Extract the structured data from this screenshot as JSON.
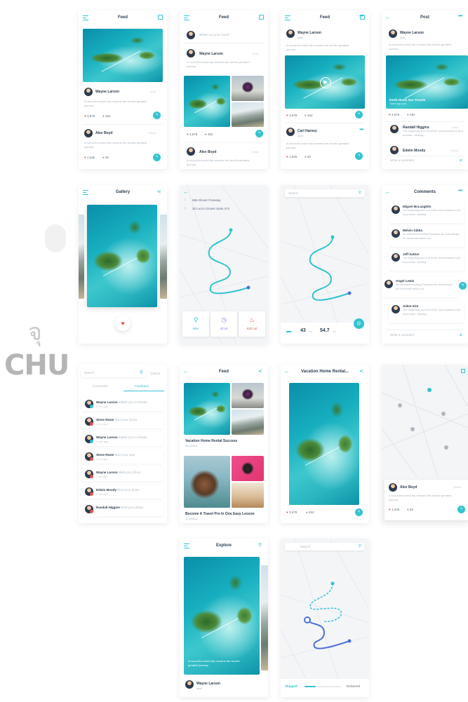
{
  "watermark": {
    "thai": "จุ",
    "latin": "CHU"
  },
  "colors": {
    "accent": "#34c3d1",
    "heart": "#e2574c",
    "route": "#4c6fd8",
    "calories": "#e2574c"
  },
  "feed1": {
    "title": "Feed",
    "post1": {
      "name": "Wayne Larson",
      "time": "2min",
      "text": "A round-the-world trip remains the world's greatest journey.",
      "likes": "3,578",
      "comments": "452"
    },
    "post2": {
      "name": "Alex Boyd",
      "time": "20min",
      "text": "A round-the-world trip remains the world's greatest journey.",
      "likes": "1,345",
      "comments": "82"
    }
  },
  "feed2": {
    "title": "Feed",
    "composer_placeholder": "What's on your mind?",
    "post1": {
      "name": "Wayne Larson",
      "time": "2min",
      "text": "A round-the-world trip remains the world's greatest journey.",
      "likes": "3,578",
      "comments": "452"
    },
    "post2": {
      "name": "Alex Boyd",
      "time": "5min",
      "text": "A round-the-world trip remains the world's greatest journey."
    }
  },
  "feed3": {
    "title": "Feed",
    "post1": {
      "name": "Wayne Larson",
      "handle": "@wl",
      "text": "A round-the-world trip remains the world's greatest journey.",
      "likes": "3,578",
      "comments": "452"
    },
    "post2": {
      "name": "Carl Harvey",
      "handle": "@ch",
      "text": "A round-the-world trip remains the world's greatest journey.",
      "likes": "1,345",
      "comments": "82"
    }
  },
  "post": {
    "title": "Post",
    "author": {
      "name": "Wayne Larson",
      "handle": "@wl"
    },
    "text": "A round-the-world trip remains the world's greatest journey.",
    "image_caption": "Earth Hosts Our Travels",
    "image_sub": "Travel app.com",
    "likes": "3,578",
    "comments": "452",
    "c1": {
      "name": "Randall Higgins",
      "time": "1min",
      "text": "The beginning and end of the novel showed a lot of promise...dealing..."
    },
    "c2": {
      "name": "Edwin Moody",
      "time": "12min"
    },
    "write_placeholder": "Write a comment"
  },
  "gallery": {
    "title": "Gallery"
  },
  "route": {
    "from": "696 Glover Freeway",
    "to": "30 Lucio Groves Suite 474",
    "bike": "Bike",
    "time": "43:16",
    "cal": "820 cal"
  },
  "map2": {
    "search_placeholder": "Search",
    "distance_min": "43",
    "distance_min_unit": "min",
    "distance_km": "54.7",
    "distance_km_unit": "km"
  },
  "comments": {
    "title": "Comments",
    "items": [
      {
        "name": "Miguel McLaughlin",
        "text": "The beginning and end of the novel showed a lot of promise...dealing..."
      },
      {
        "name": "Melvin Gibbs",
        "text": "As collective traveling Parapers we must always be concerned about our"
      },
      {
        "name": "Jeff Sutton",
        "text": "The beginning and end of the novel showed a lot of promise...dealing..."
      },
      {
        "name": "Angel Lewis",
        "text": "As collective traveling Parapers we must always be concerned about our"
      },
      {
        "name": "Aiden Kim",
        "text": "The beginning and end of the novel showed a lot of promise...dealing..."
      }
    ],
    "write_placeholder": "Write a comment"
  },
  "notifications": {
    "search_placeholder": "Search",
    "cancel": "Cancel",
    "tab1": "Comments",
    "tab2": "Feedback",
    "items": [
      {
        "name": "Wayne Larson",
        "action": "added you to friends",
        "ago": "2 hrs ago"
      },
      {
        "name": "Steve Rowe",
        "action": "liked your photo",
        "ago": "3 hrs ago"
      },
      {
        "name": "Wayne Larson",
        "action": "added you to friends",
        "ago": "1 day ago"
      },
      {
        "name": "Steve Rowe",
        "action": "liked your post",
        "ago": "2 hrs ago"
      },
      {
        "name": "Wayne Larson",
        "action": "liked your photo",
        "ago": "1 hrs ago"
      },
      {
        "name": "Edwin Moody",
        "action": "liked your photo",
        "ago": "2 hrs ago"
      },
      {
        "name": "Randall Higgins",
        "action": "liked your photo",
        "ago": ""
      }
    ]
  },
  "feed4": {
    "title": "Feed",
    "album1": {
      "title": "Vacation Home Rental Success",
      "count": "46 photos"
    },
    "album2": {
      "title": "Become A Travel Pro In One Easy Lesson",
      "count": "32 photos"
    }
  },
  "vacation": {
    "title": "Vacation Home Rental...",
    "likes": "3,578",
    "comments": "452"
  },
  "map3": {
    "post": {
      "name": "Alex Boyd",
      "time": "20min",
      "text": "A round-the-world trip remains the world's greatest journey.",
      "likes": "1,345",
      "comments": "82"
    }
  },
  "explore": {
    "title": "Explore",
    "caption": "A round-the-world trip remains the world's greatest journey.",
    "author": "Wayne Larson",
    "handle": "@wl"
  },
  "tracking": {
    "search_placeholder": "Search",
    "shipped": "Shipped",
    "delivered": "Delivered",
    "progress": 0.3
  }
}
